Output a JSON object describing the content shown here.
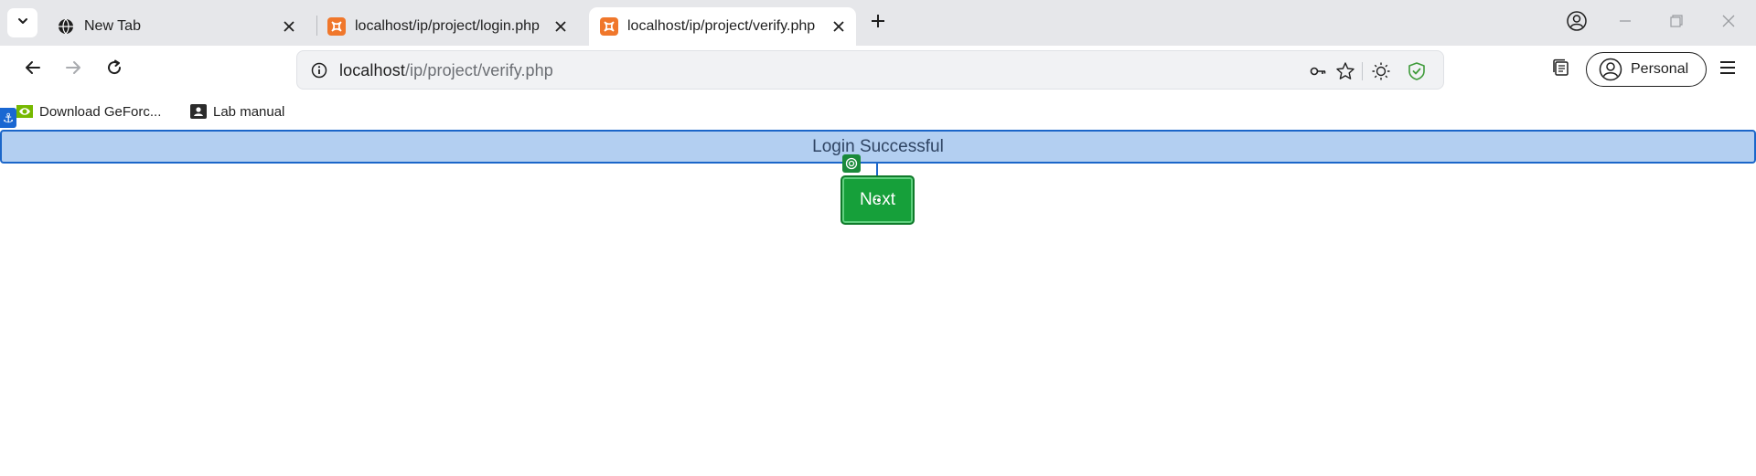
{
  "browser": {
    "tabs": [
      {
        "title": "New Tab",
        "icon": "globe-icon",
        "active": false
      },
      {
        "title": "localhost/ip/project/login.php",
        "icon": "xampp-icon",
        "active": false
      },
      {
        "title": "localhost/ip/project/verify.php",
        "icon": "xampp-icon",
        "active": true
      }
    ],
    "address": {
      "host": "localhost",
      "path": "/ip/project/verify.php"
    },
    "profile_label": "Personal",
    "bookmarks": [
      {
        "label": "Download GeForc...",
        "icon": "nvidia-icon"
      },
      {
        "label": "Lab manual",
        "icon": "profile-card-icon"
      }
    ],
    "accent_color": "#1b66c9",
    "xampp_color": "#f0772b"
  },
  "page": {
    "alert_text": "Login Successful",
    "alert_bg": "#b3cff1",
    "next_label": "Next",
    "next_color": "#16a03a"
  }
}
